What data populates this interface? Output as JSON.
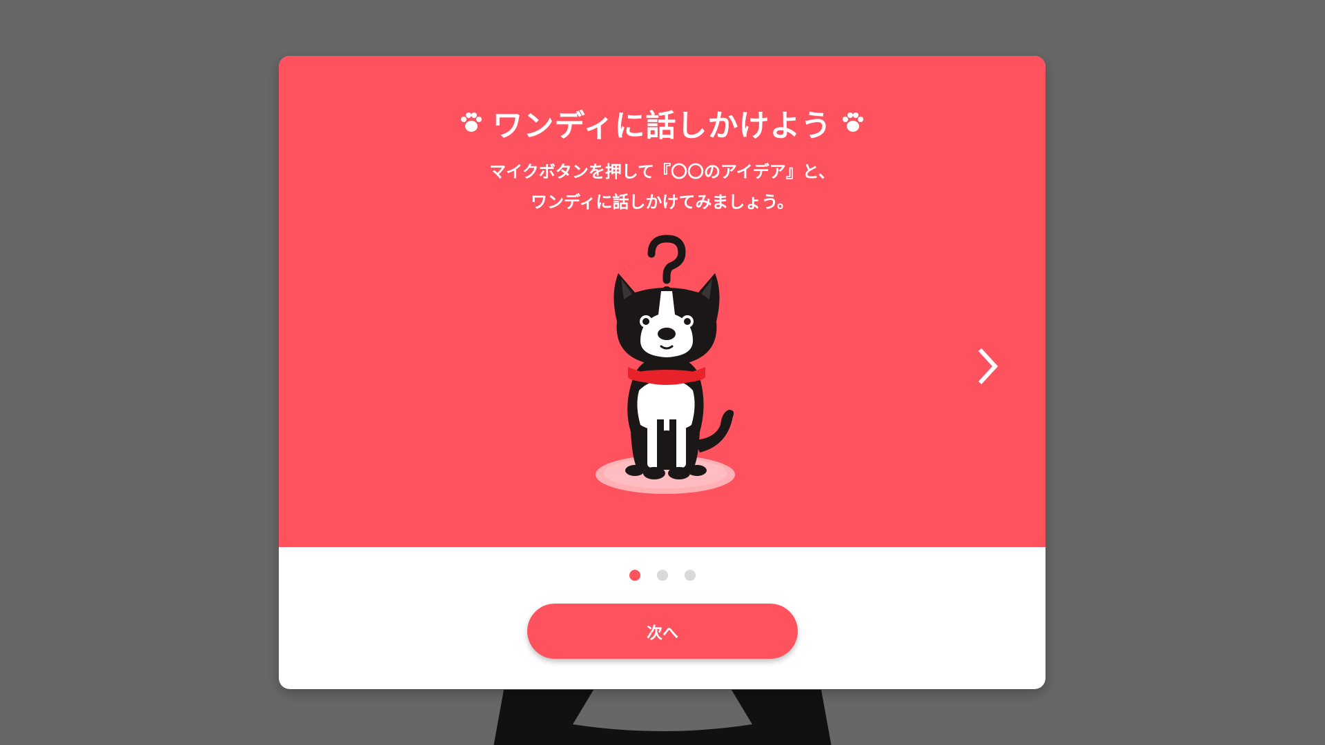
{
  "modal": {
    "title": "ワンディに話しかけよう",
    "subtitle_line1": "マイクボタンを押して『〇〇のアイデア』と、",
    "subtitle_line2": "ワンディに話しかけてみましょう。",
    "next_button_label": "次へ",
    "pagination": {
      "total": 3,
      "current": 1
    },
    "icons": [
      "paw-icon",
      "paw-icon",
      "chevron-right-icon"
    ]
  },
  "colors": {
    "accent": "#fe525f",
    "background_overlay": "#676767",
    "dot_inactive": "#d9d9d9",
    "collar": "#e8222a"
  }
}
